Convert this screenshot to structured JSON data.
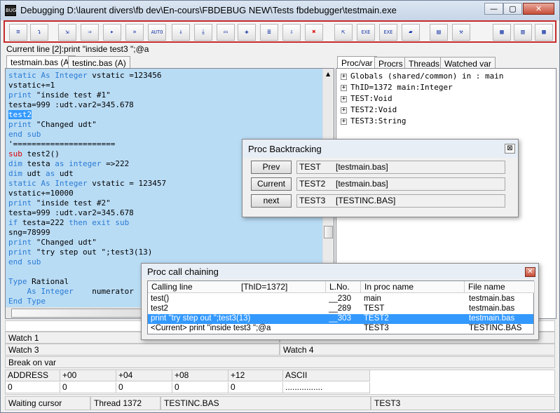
{
  "window": {
    "title": "Debugging D:\\laurent divers\\fb dev\\En-cours\\FBDEBUG NEW\\Tests fbdebugger\\testmain.exe",
    "app_icon_text": "BUG",
    "controls": {
      "minimize": "—",
      "maximize": "▢",
      "close": "✕"
    }
  },
  "toolbar": {
    "buttons": [
      {
        "name": "step-button",
        "icon": "step-icon",
        "glyph": "≡"
      },
      {
        "name": "step-over-button",
        "icon": "step-over-icon",
        "glyph": "↴"
      },
      {
        "name": "step-out-button",
        "icon": "step-out-icon",
        "glyph": "⇲"
      },
      {
        "name": "step-in-button",
        "icon": "step-in-icon",
        "glyph": "⇒"
      },
      {
        "name": "run-to-cursor-button",
        "icon": "cursor-icon",
        "glyph": "▸"
      },
      {
        "name": "fast-run-button",
        "icon": "fast-run-icon",
        "glyph": "»"
      },
      {
        "name": "auto-button",
        "icon": "auto-icon",
        "glyph": "AUTO"
      },
      {
        "name": "run-button",
        "icon": "run-icon",
        "glyph": "⇓"
      },
      {
        "name": "run-end-button",
        "icon": "run-end-icon",
        "glyph": "⤓"
      },
      {
        "name": "window-button",
        "icon": "window-icon",
        "glyph": "▭"
      },
      {
        "name": "breakpoint-button",
        "icon": "breakpoint-icon",
        "glyph": "✚"
      },
      {
        "name": "break-list-button",
        "icon": "list-icon",
        "glyph": "≣"
      },
      {
        "name": "down-list-button",
        "icon": "down-arrow-icon",
        "glyph": "⇩"
      },
      {
        "name": "kill-button",
        "icon": "kill-x-icon",
        "glyph": "✖"
      },
      {
        "name": "restart-button",
        "icon": "restart-icon",
        "glyph": "⇱"
      },
      {
        "name": "exe-list-button",
        "icon": "exe-list-icon",
        "glyph": "EXE"
      },
      {
        "name": "exe-button",
        "icon": "exe-icon",
        "glyph": "EXE"
      },
      {
        "name": "open-button",
        "icon": "folder-icon",
        "glyph": "▰"
      },
      {
        "name": "notes-button",
        "icon": "notes-icon",
        "glyph": "▤"
      },
      {
        "name": "tools-button",
        "icon": "tools-icon",
        "glyph": "⚒"
      },
      {
        "name": "view-1-button",
        "icon": "view-icon",
        "glyph": "▦"
      },
      {
        "name": "view-2-button",
        "icon": "view-icon",
        "glyph": "▥"
      },
      {
        "name": "view-3-button",
        "icon": "grid-icon",
        "glyph": "▩"
      }
    ]
  },
  "current_line": "Current line [2]:print \"inside test3 \";@a",
  "source_tabs": [
    {
      "label": "testmain.bas (A)",
      "active": true
    },
    {
      "label": "testinc.bas (A)",
      "active": false
    }
  ],
  "code_lines": [
    [
      {
        "t": "static As Integer",
        "c": "kw"
      },
      {
        "t": " vstatic =123456"
      }
    ],
    [
      {
        "t": "vstatic+=1"
      }
    ],
    [
      {
        "t": "print",
        "c": "kw"
      },
      {
        "t": " \"inside test #1\""
      }
    ],
    [
      {
        "t": "testa=999 :udt.var2=345.678"
      }
    ],
    [
      {
        "t": "test2",
        "c": "sel"
      }
    ],
    [
      {
        "t": "print",
        "c": "kw"
      },
      {
        "t": " \"Changed udt\""
      }
    ],
    [
      {
        "t": "end sub",
        "c": "kw"
      }
    ],
    [
      {
        "t": "'======================"
      }
    ],
    [
      {
        "t": "sub",
        "c": "red"
      },
      {
        "t": " test2()"
      }
    ],
    [
      {
        "t": "dim",
        "c": "kw"
      },
      {
        "t": " testa "
      },
      {
        "t": "as integer",
        "c": "kw"
      },
      {
        "t": " =>222"
      }
    ],
    [
      {
        "t": "dim",
        "c": "kw"
      },
      {
        "t": " udt "
      },
      {
        "t": "as",
        "c": "kw"
      },
      {
        "t": " udt"
      }
    ],
    [
      {
        "t": "static As Integer",
        "c": "kw"
      },
      {
        "t": " vstatic = 123457"
      }
    ],
    [
      {
        "t": "vstatic+=10000"
      }
    ],
    [
      {
        "t": "print",
        "c": "kw"
      },
      {
        "t": " \"inside test #2\""
      }
    ],
    [
      {
        "t": "testa=999 :udt.var2=345.678"
      }
    ],
    [
      {
        "t": "if",
        "c": "kw"
      },
      {
        "t": " testa=222 "
      },
      {
        "t": "then exit sub",
        "c": "kw"
      }
    ],
    [
      {
        "t": "sng=78999"
      }
    ],
    [
      {
        "t": "print",
        "c": "kw"
      },
      {
        "t": " \"Changed udt\""
      }
    ],
    [
      {
        "t": "print",
        "c": "kw"
      },
      {
        "t": " \"try step out \";test3(13)"
      }
    ],
    [
      {
        "t": "end sub",
        "c": "kw"
      }
    ],
    [
      {
        "t": ""
      }
    ],
    [
      {
        "t": "Type",
        "c": "kw"
      },
      {
        "t": " Rational"
      }
    ],
    [
      {
        "t": "    "
      },
      {
        "t": "As Integer",
        "c": "kw"
      },
      {
        "t": "    numerator"
      }
    ],
    [
      {
        "t": "End Type",
        "c": "kw"
      }
    ]
  ],
  "right_tabs": [
    {
      "label": "Proc/var",
      "active": true
    },
    {
      "label": "Procrs",
      "active": false
    },
    {
      "label": "Threads",
      "active": false
    },
    {
      "label": "Watched var",
      "active": false
    }
  ],
  "tree_items": [
    "Globals (shared/common) in : main",
    "ThID=1372 main:Integer",
    "TEST:Void",
    "TEST2:Void",
    "TEST3:String"
  ],
  "watch": {
    "watch1": "Watch 1",
    "watch3": "Watch 3",
    "watch4": "Watch 4",
    "break_on_var": "Break on var"
  },
  "memory": {
    "headers": [
      "ADDRESS",
      "+00",
      "+04",
      "+08",
      "+12",
      "ASCII"
    ],
    "row": [
      "0",
      "0",
      "0",
      "0",
      "0",
      "................"
    ]
  },
  "status": {
    "state": "Waiting cursor",
    "thread": "Thread 1372",
    "file": "TESTINC.BAS",
    "proc": "TEST3"
  },
  "backtracking": {
    "title": "Proc Backtracking",
    "close": "⊠",
    "rows": [
      {
        "button": "Prev",
        "proc": "TEST",
        "file": "[testmain.bas]"
      },
      {
        "button": "Current",
        "proc": "TEST2",
        "file": "[testmain.bas]"
      },
      {
        "button": "next",
        "proc": "TEST3",
        "file": "[TESTINC.BAS]"
      }
    ]
  },
  "chaining": {
    "title": "Proc call chaining",
    "close": "✕",
    "headers": [
      "Calling line",
      "[ThID=1372]",
      "L.No.",
      "In proc name",
      "File name"
    ],
    "rows": [
      {
        "line": "test()",
        "lno": "__230",
        "proc": "main",
        "file": "testmain.bas",
        "selected": false
      },
      {
        "line": "test2",
        "lno": "__289",
        "proc": "TEST",
        "file": "testmain.bas",
        "selected": false
      },
      {
        "line": "print \"try step out \";test3(13)",
        "lno": "__303",
        "proc": "TEST2",
        "file": "testmain.bas",
        "selected": true
      },
      {
        "line": "<Current> print \"inside test3 \";@a",
        "lno": "",
        "proc": "TEST3",
        "file": "TESTINC.BAS",
        "selected": false
      }
    ]
  }
}
